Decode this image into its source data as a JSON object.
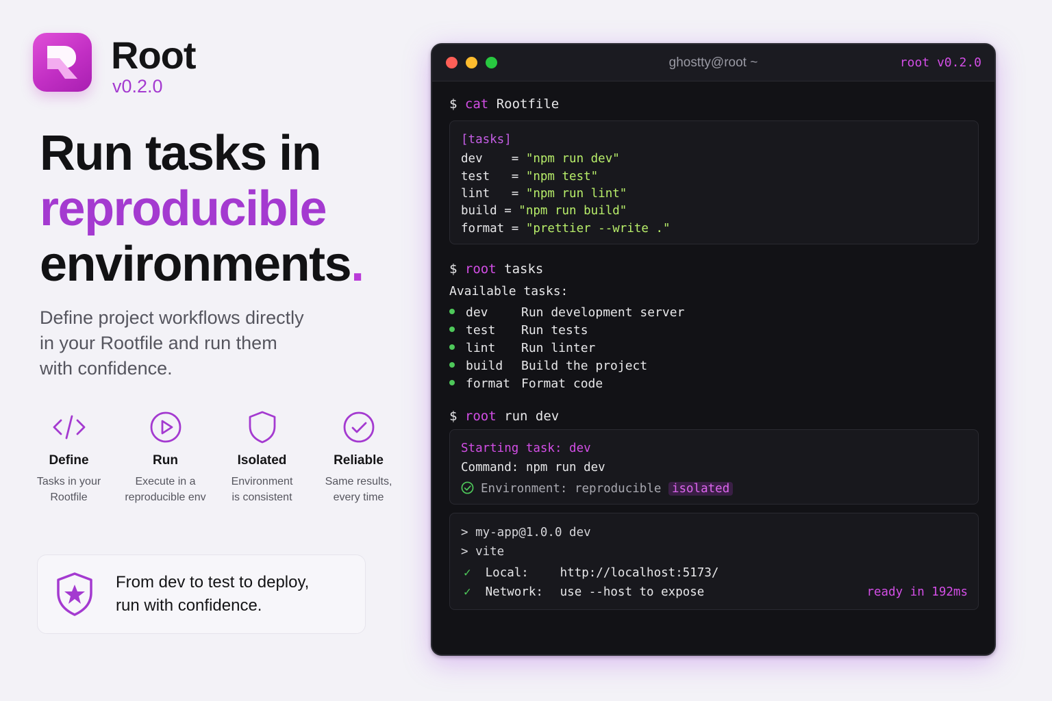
{
  "brand": {
    "name": "Root",
    "version": "v0.2.0",
    "logo_icon": "root-logo-icon"
  },
  "headline": {
    "line1": "Run tasks in",
    "line2": "reproducible",
    "line3": "environments",
    "dot": "."
  },
  "subhead": {
    "line1": "Define project workflows directly",
    "line2": "in your Rootfile and run them",
    "line3": "with confidence."
  },
  "features": [
    {
      "icon": "code-icon",
      "title": "Define",
      "desc1": "Tasks in your",
      "desc2": "Rootfile"
    },
    {
      "icon": "play-circle-icon",
      "title": "Run",
      "desc1": "Execute in a",
      "desc2": "reproducible env"
    },
    {
      "icon": "shield-icon",
      "title": "Isolated",
      "desc1": "Environment",
      "desc2": "is consistent"
    },
    {
      "icon": "check-circle-icon",
      "title": "Reliable",
      "desc1": "Same results,",
      "desc2": "every time"
    }
  ],
  "promo": {
    "icon": "shield-star-icon",
    "line1": "From dev to test to deploy,",
    "line2": "run with confidence."
  },
  "colors": {
    "accent": "#a43ad0",
    "terminal_bg": "#121216",
    "string": "#b8ee6a",
    "success": "#4ec85a"
  },
  "terminal": {
    "title": "ghostty@root ~",
    "version": "root v0.2.0",
    "prompt": "$",
    "cmd1": {
      "keyword": "cat",
      "arg": "Rootfile"
    },
    "rootfile": {
      "section": "[tasks]",
      "entries": [
        {
          "key": "dev    = ",
          "value": "\"npm run dev\""
        },
        {
          "key": "test   = ",
          "value": "\"npm test\""
        },
        {
          "key": "lint   = ",
          "value": "\"npm run lint\""
        },
        {
          "key": "build = ",
          "value": "\"npm run build\""
        },
        {
          "key": "format = ",
          "value": "\"prettier --write .\""
        }
      ]
    },
    "cmd2": {
      "keyword": "root",
      "arg": "tasks"
    },
    "tasks_header": "Available tasks:",
    "tasks": [
      {
        "name": "dev",
        "desc": "Run development server"
      },
      {
        "name": "test",
        "desc": "Run tests"
      },
      {
        "name": "lint",
        "desc": "Run linter"
      },
      {
        "name": "build",
        "desc": "Build the project"
      },
      {
        "name": "format",
        "desc": "Format code"
      }
    ],
    "cmd3": {
      "keyword": "root",
      "arg": "run dev"
    },
    "run_output": {
      "starting": "Starting task: dev",
      "command": "Command: npm run dev",
      "env_label": "Environment: reproducible",
      "env_tag": "isolated"
    },
    "vite_output": {
      "line1": "> my-app@1.0.0 dev",
      "line2": "> vite",
      "check": "✓",
      "local_label": "Local:",
      "local_value": "http://localhost:5173/",
      "network_label": "Network:",
      "network_value": "use --host to expose",
      "ready": "ready in 192ms"
    }
  }
}
